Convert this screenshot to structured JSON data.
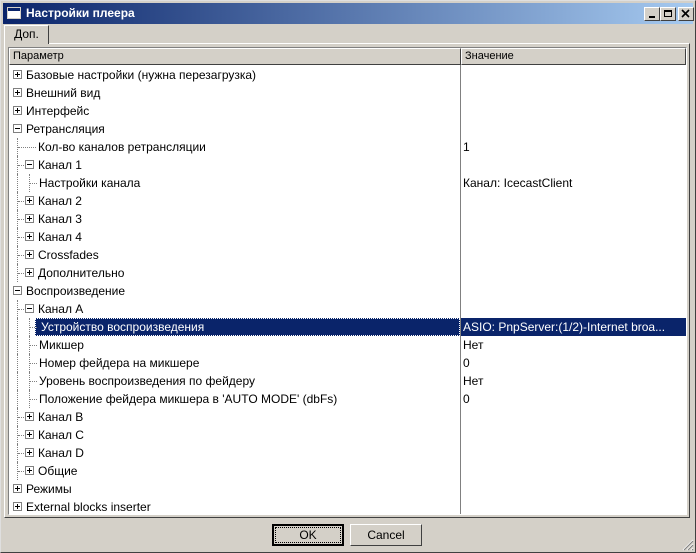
{
  "window": {
    "title": "Настройки плеера"
  },
  "tab": {
    "label": "Доп."
  },
  "grid": {
    "header_param": "Параметр",
    "header_value": "Значение",
    "rows": [
      {
        "label": "Базовые настройки (нужна перезагрузка)",
        "value": "",
        "level": 0,
        "expander": "plus"
      },
      {
        "label": "Внешний вид",
        "value": "",
        "level": 0,
        "expander": "plus"
      },
      {
        "label": "Интерфейс",
        "value": "",
        "level": 0,
        "expander": "plus"
      },
      {
        "label": "Ретрансляция",
        "value": "",
        "level": 0,
        "expander": "minus"
      },
      {
        "label": "Кол-во каналов ретрансляции",
        "value": "1",
        "level": 1,
        "expander": "none"
      },
      {
        "label": "Канал 1",
        "value": "",
        "level": 1,
        "expander": "minus"
      },
      {
        "label": "Настройки канала",
        "value": "Канал:  IcecastClient",
        "level": 2,
        "expander": "none"
      },
      {
        "label": "Канал 2",
        "value": "",
        "level": 1,
        "expander": "plus"
      },
      {
        "label": "Канал 3",
        "value": "",
        "level": 1,
        "expander": "plus"
      },
      {
        "label": "Канал 4",
        "value": "",
        "level": 1,
        "expander": "plus"
      },
      {
        "label": "Crossfades",
        "value": "",
        "level": 1,
        "expander": "plus"
      },
      {
        "label": "Дополнительно",
        "value": "",
        "level": 1,
        "expander": "plus"
      },
      {
        "label": "Воспроизведение",
        "value": "",
        "level": 0,
        "expander": "minus"
      },
      {
        "label": "Канал A",
        "value": "",
        "level": 1,
        "expander": "minus"
      },
      {
        "label": "Устройство воспроизведения",
        "value": "ASIO: PnpServer:(1/2)-Internet broa...",
        "level": 2,
        "expander": "none",
        "selected": true
      },
      {
        "label": "Микшер",
        "value": "Нет",
        "level": 2,
        "expander": "none"
      },
      {
        "label": "Номер фейдера на микшере",
        "value": "0",
        "level": 2,
        "expander": "none"
      },
      {
        "label": "Уровень воспроизведения по фейдеру",
        "value": "Нет",
        "level": 2,
        "expander": "none"
      },
      {
        "label": "Положение фейдера микшера в 'AUTO MODE' (dbFs)",
        "value": "0",
        "level": 2,
        "expander": "none"
      },
      {
        "label": "Канал B",
        "value": "",
        "level": 1,
        "expander": "plus"
      },
      {
        "label": "Канал C",
        "value": "",
        "level": 1,
        "expander": "plus"
      },
      {
        "label": "Канал D",
        "value": "",
        "level": 1,
        "expander": "plus"
      },
      {
        "label": "Общие",
        "value": "",
        "level": 1,
        "expander": "plus"
      },
      {
        "label": "Режимы",
        "value": "",
        "level": 0,
        "expander": "plus"
      },
      {
        "label": "External blocks inserter",
        "value": "",
        "level": 0,
        "expander": "plus"
      }
    ]
  },
  "buttons": {
    "ok_label": "OK",
    "cancel_label": "Cancel"
  },
  "colors": {
    "selection": "#0a246a",
    "face": "#d4d0c8"
  }
}
